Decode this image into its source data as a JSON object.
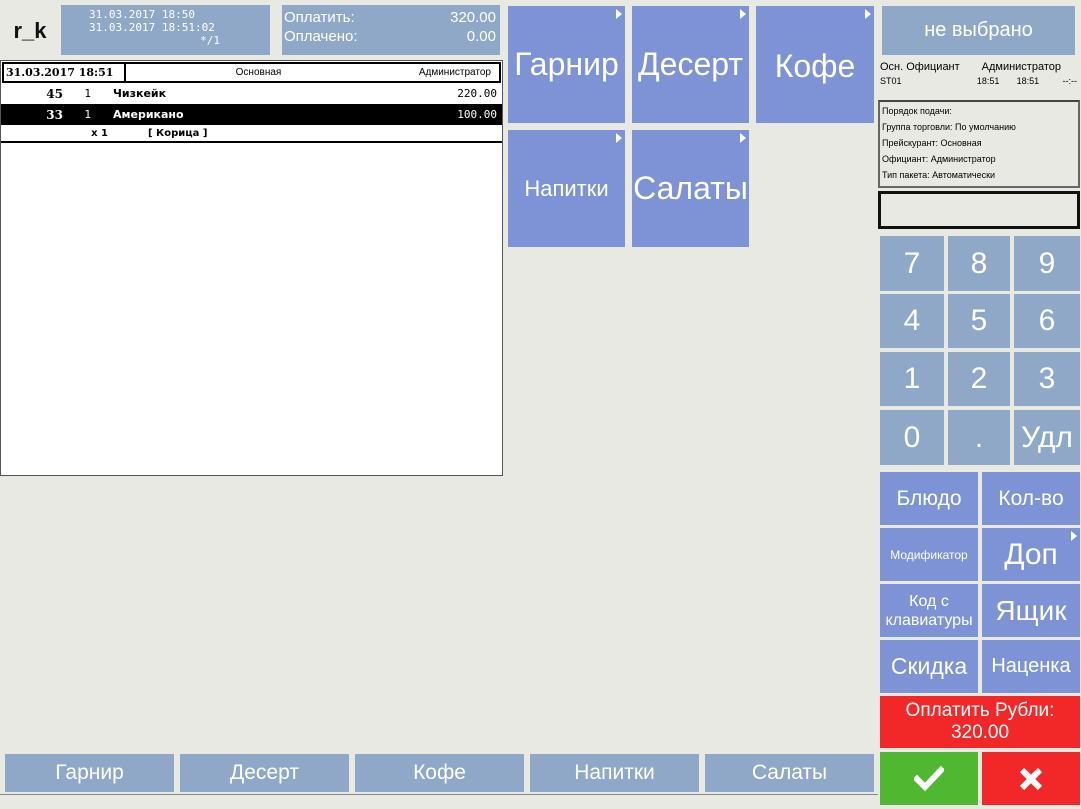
{
  "header": {
    "logo": "r_k",
    "date_opened": "31.03.2017 18:50",
    "date_now": "31.03.2017 18:51:02",
    "table_no": "*/1",
    "to_pay_label": "Оплатить:",
    "to_pay_value": "320.00",
    "paid_label": "Оплачено:",
    "paid_value": "0.00"
  },
  "receipt": {
    "header": {
      "date": "31.03.2017 18:51",
      "menu": "Основная",
      "user": "Администратор"
    },
    "lines": [
      {
        "code": "45",
        "qty": "1",
        "name": "Чизкейк",
        "price": "220.00",
        "selected": false
      },
      {
        "code": "33",
        "qty": "1",
        "name": "Американо",
        "price": "100.00",
        "selected": true
      }
    ],
    "modifier": {
      "qty": "x 1",
      "name": "[ Корица ]"
    }
  },
  "categories": {
    "garnish": "Гарнир",
    "dessert": "Десерт",
    "coffee": "Кофе",
    "drinks": "Напитки",
    "salads": "Салаты"
  },
  "right": {
    "not_selected": "не выбрано",
    "waiter_label": "Осн. Официант",
    "waiter_name": "Администратор",
    "station": "ST01",
    "time1": "18:51",
    "time2": "18:51",
    "time3": "--:--",
    "info": [
      "Порядок подачи:",
      "Группа торговли: По умолчанию",
      "Прейскурант: Основная",
      "Официант: Администратор",
      "Тип пакета: Автоматически"
    ]
  },
  "keypad": {
    "k7": "7",
    "k8": "8",
    "k9": "9",
    "k4": "4",
    "k5": "5",
    "k6": "6",
    "k1": "1",
    "k2": "2",
    "k3": "3",
    "k0": "0",
    "kdot": ".",
    "kdel": "Удл"
  },
  "functions": {
    "dish": "Блюдо",
    "qty": "Кол-во",
    "modifier": "Модификатор",
    "extra": "Доп",
    "keyboard_code": "Код с клавиатуры",
    "drawer": "Ящик",
    "discount": "Скидка",
    "markup": "Наценка",
    "pay_label": "Оплатить Рубли:",
    "pay_value": "320.00"
  },
  "bottom_tabs": [
    "Гарнир",
    "Десерт",
    "Кофе",
    "Напитки",
    "Салаты"
  ],
  "colors": {
    "tile_blue": "#7d93d6",
    "steel": "#8fa8c8",
    "red": "#f22828",
    "green": "#4fb830"
  }
}
